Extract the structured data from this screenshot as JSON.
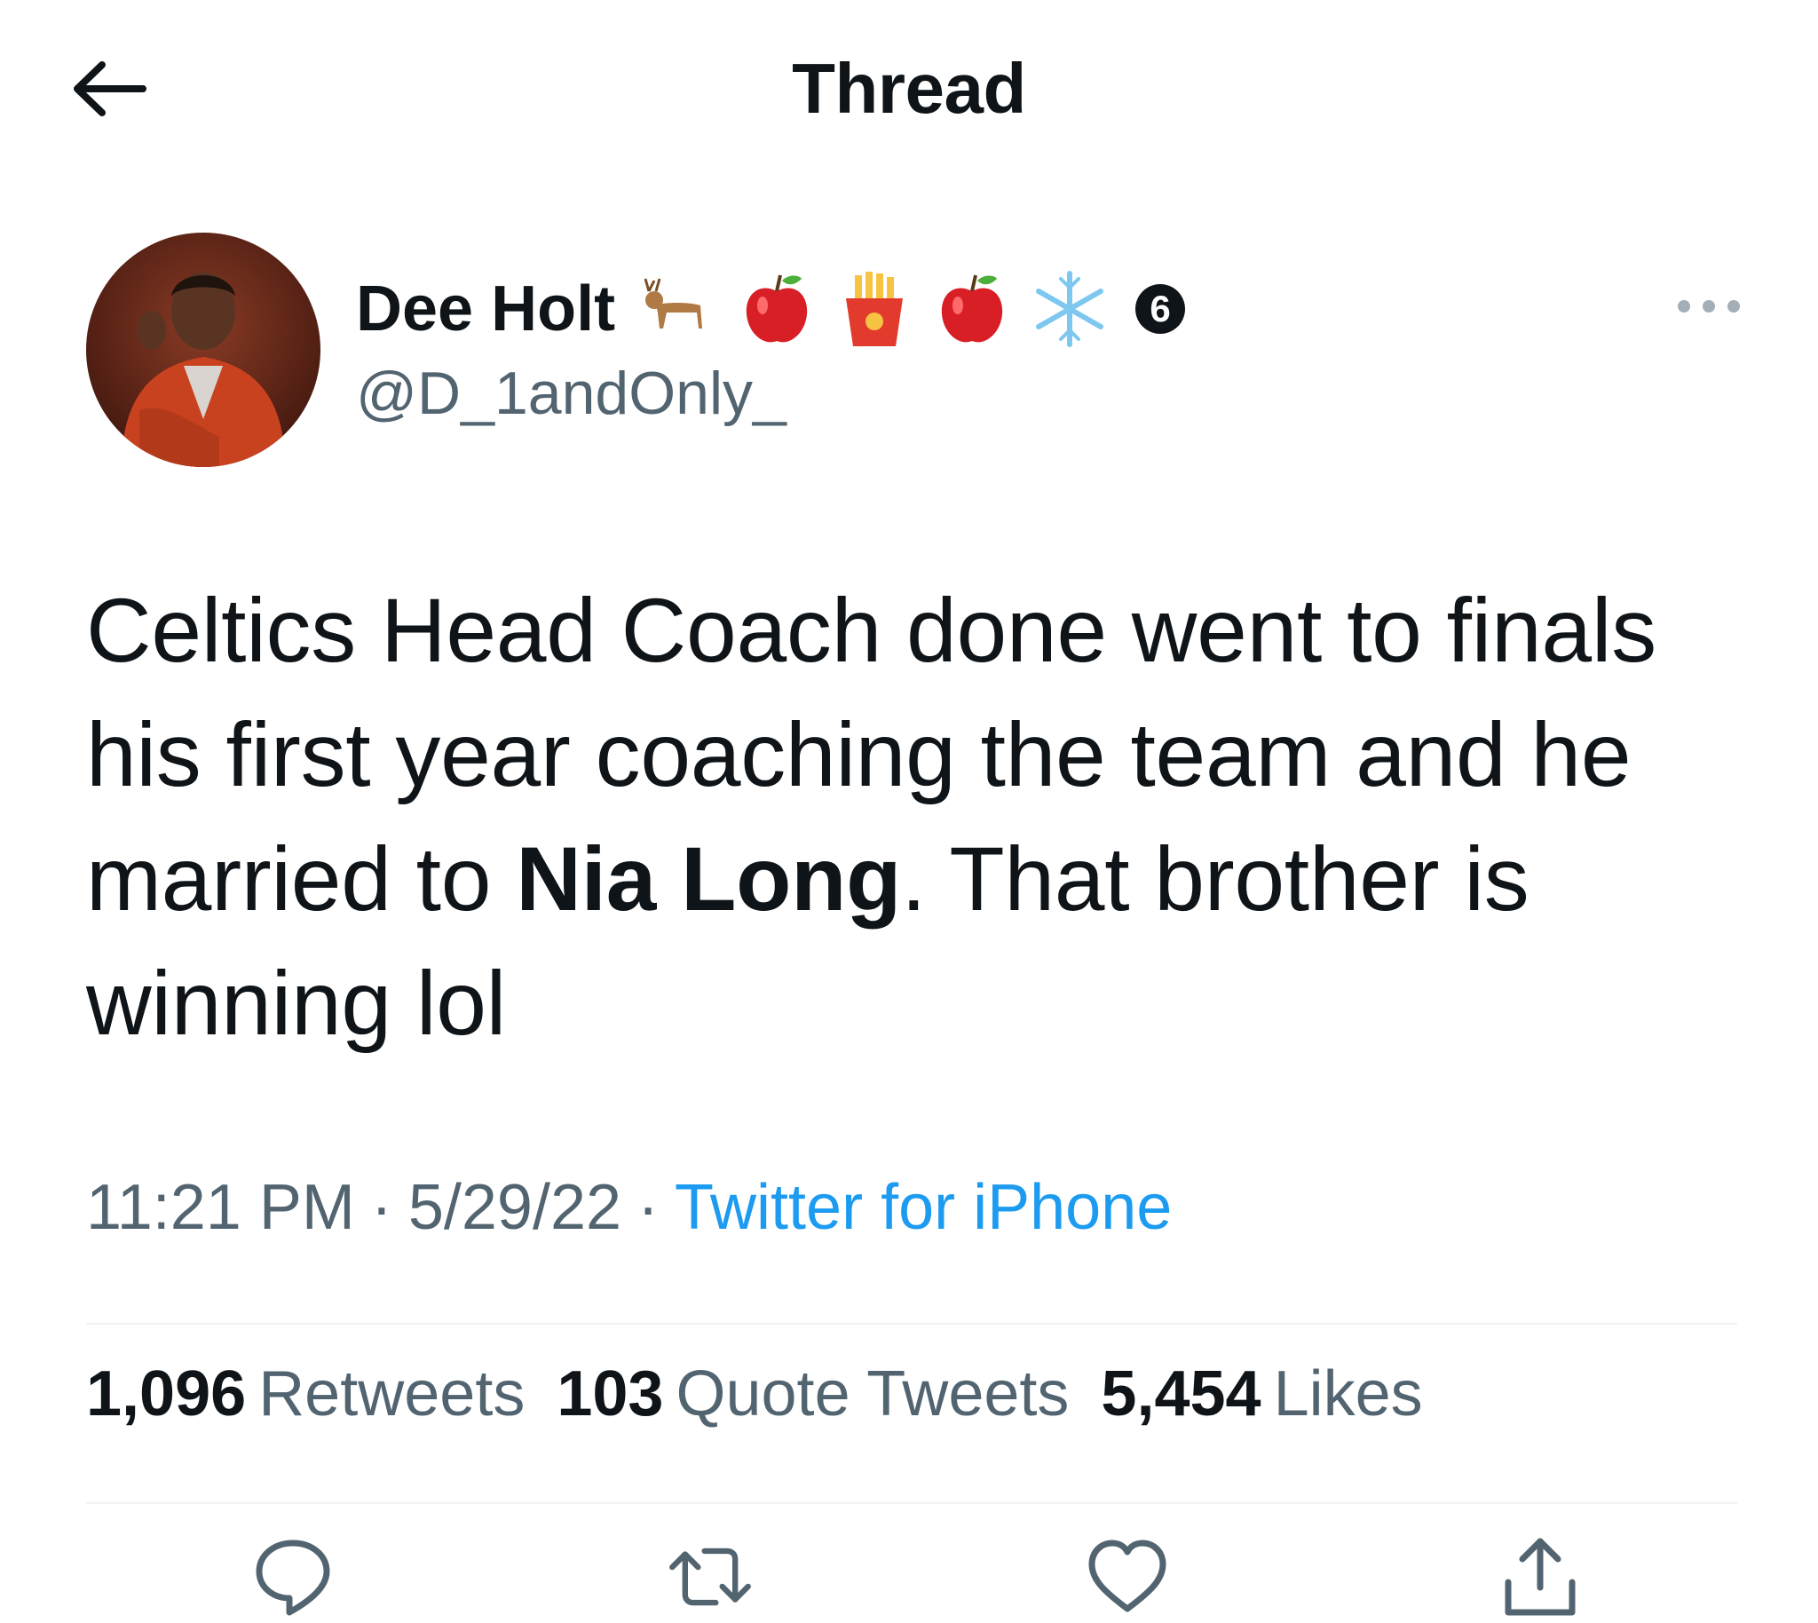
{
  "header": {
    "title": "Thread",
    "back_icon": "arrow-left-icon"
  },
  "author": {
    "display_name": "Dee Holt",
    "name_emojis": [
      "deer",
      "red-apple",
      "french-fries",
      "red-apple",
      "snowflake"
    ],
    "name_badge": "6",
    "handle": "@D_1andOnly_",
    "more_icon": "more-horizontal-icon"
  },
  "tweet": {
    "text_before": "Celtics Head Coach done went to finals his first year coaching the team and he married to ",
    "text_bold": "Nia Long",
    "text_after": ". That brother is winning lol"
  },
  "meta": {
    "time": "11:21 PM",
    "separator": "·",
    "date": "5/29/22",
    "source": "Twitter for iPhone"
  },
  "stats": {
    "retweets_count": "1,096",
    "retweets_label": "Retweets",
    "quotes_count": "103",
    "quotes_label": "Quote Tweets",
    "likes_count": "5,454",
    "likes_label": "Likes"
  },
  "actions": {
    "reply_icon": "reply-icon",
    "retweet_icon": "retweet-icon",
    "like_icon": "like-icon",
    "share_icon": "share-icon"
  },
  "colors": {
    "text": "#0f1419",
    "secondary": "#536471",
    "link": "#1d9bf0",
    "divider": "#eff3f4"
  }
}
